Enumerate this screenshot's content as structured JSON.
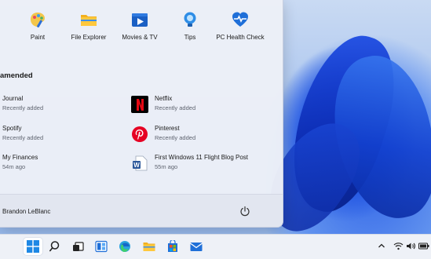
{
  "pinned": [
    {
      "label": "Paint",
      "icon": "paint-icon"
    },
    {
      "label": "File Explorer",
      "icon": "folder-icon"
    },
    {
      "label": "Movies & TV",
      "icon": "movies-tv-icon"
    },
    {
      "label": "Tips",
      "icon": "tips-bulb-icon"
    },
    {
      "label": "PC Health Check",
      "icon": "heart-pulse-icon"
    }
  ],
  "recommended": {
    "title": "amended",
    "items": [
      {
        "name": "Journal",
        "sub": "Recently added"
      },
      {
        "name": "Netflix",
        "sub": "Recently added",
        "icon": "netflix-icon"
      },
      {
        "name": "Spotify",
        "sub": "Recently added"
      },
      {
        "name": "Pinterest",
        "sub": "Recently added",
        "icon": "pinterest-icon"
      },
      {
        "name": "My Finances",
        "sub": "54m ago"
      },
      {
        "name": "First Windows 11 Flight Blog Post",
        "sub": "55m ago",
        "icon": "word-document-icon"
      }
    ]
  },
  "user": {
    "name": "Brandon LeBlanc"
  },
  "colors": {
    "accent": "#0067c0",
    "netflix_red": "#e50914",
    "pinterest_red": "#e60023",
    "word_blue": "#2b579a"
  },
  "taskbar": {
    "items": [
      "windows-start-icon",
      "search-icon",
      "task-view-icon",
      "widgets-icon",
      "edge-icon",
      "file-explorer-icon",
      "store-icon",
      "mail-icon"
    ],
    "tray": [
      "chevron-up-icon",
      "wifi-icon",
      "speaker-icon",
      "battery-icon"
    ]
  }
}
